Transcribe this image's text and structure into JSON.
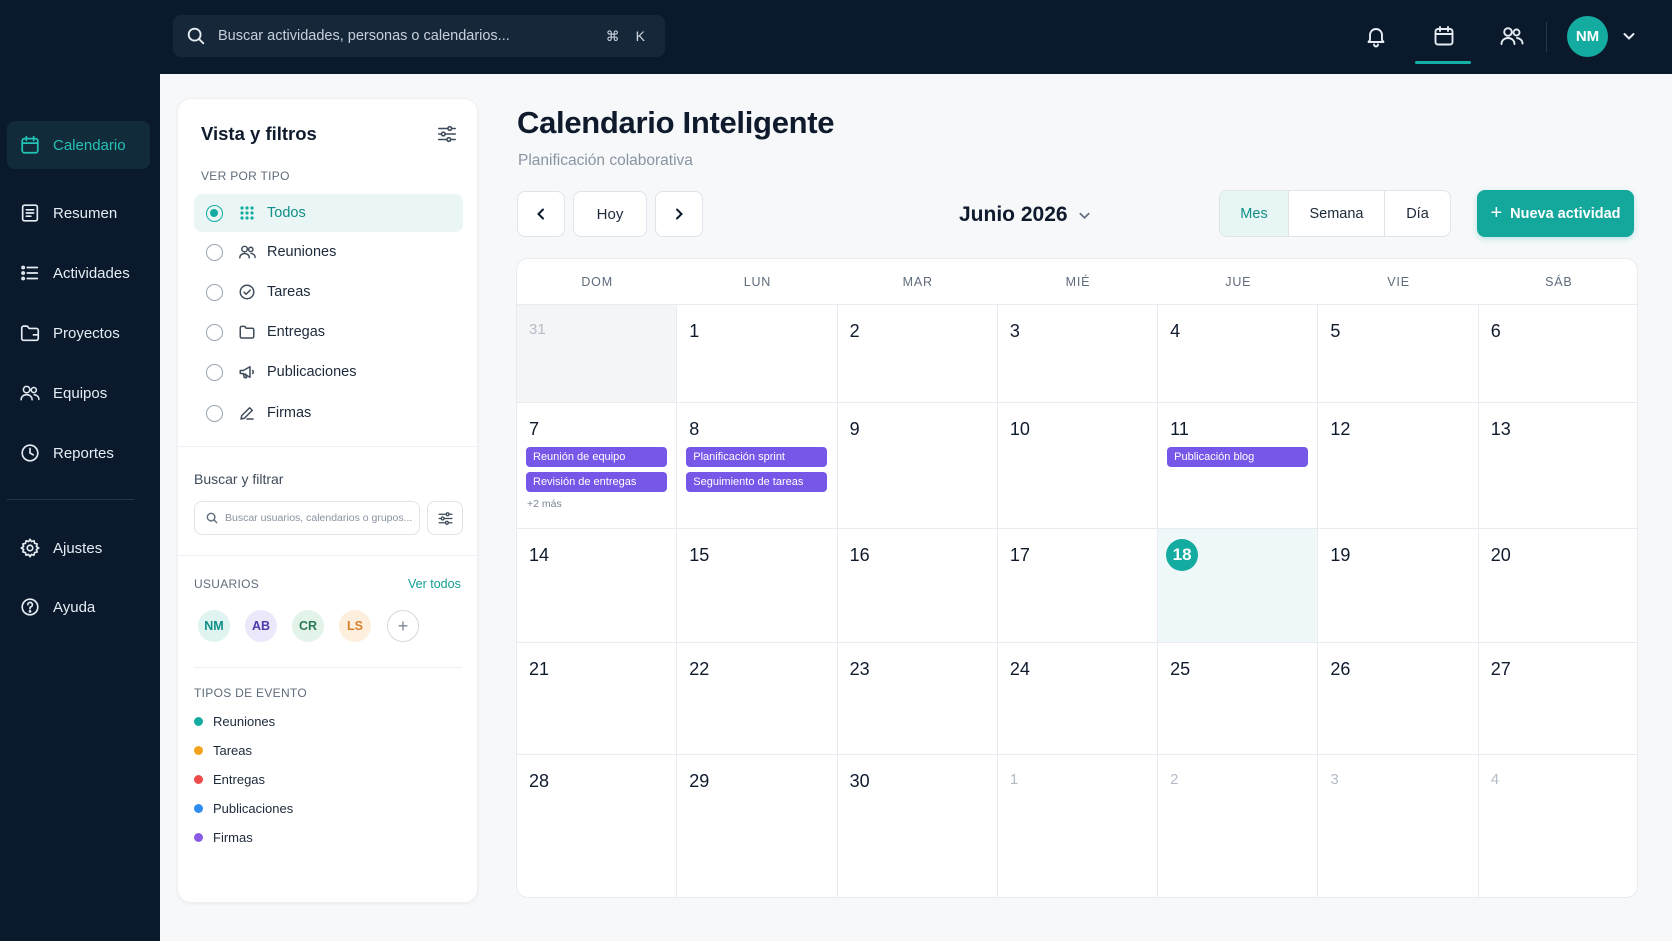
{
  "topbar": {
    "search_placeholder": "Buscar actividades, personas o calendarios...",
    "shortcut": "⌘ K",
    "avatar_initials": "NM",
    "icons": [
      "bell-icon",
      "calendar-icon",
      "users-icon",
      "chevron-down-icon"
    ]
  },
  "nav": {
    "items": [
      {
        "label": "Calendario",
        "icon": "calendar-icon",
        "active": true
      },
      {
        "label": "Resumen",
        "icon": "summary-icon"
      },
      {
        "label": "Actividades",
        "icon": "list-icon"
      },
      {
        "label": "Proyectos",
        "icon": "folder-icon"
      },
      {
        "label": "Equipos",
        "icon": "users-icon"
      },
      {
        "label": "Reportes",
        "icon": "clock-icon"
      },
      {
        "label": "Ajustes",
        "icon": "gear-icon"
      },
      {
        "label": "Ayuda",
        "icon": "help-icon"
      }
    ]
  },
  "filters": {
    "title": "Vista y filtros",
    "by_type_label": "VER POR TIPO",
    "types": [
      {
        "label": "Todos",
        "icon": "grid-icon",
        "selected": true
      },
      {
        "label": "Reuniones",
        "icon": "users-icon"
      },
      {
        "label": "Tareas",
        "icon": "check-circle-icon"
      },
      {
        "label": "Entregas",
        "icon": "folder-icon"
      },
      {
        "label": "Publicaciones",
        "icon": "megaphone-icon"
      },
      {
        "label": "Firmas",
        "icon": "pen-icon"
      }
    ],
    "search_heading": "Buscar y filtrar",
    "search_placeholder": "Buscar usuarios, calendarios o grupos...",
    "users_label": "USUARIOS",
    "see_all": "Ver todos",
    "users": [
      {
        "initials": "NM",
        "bg": "#dff3f1",
        "fg": "#0f8f87"
      },
      {
        "initials": "AB",
        "bg": "#ece8fb",
        "fg": "#4a3aa8"
      },
      {
        "initials": "CR",
        "bg": "#e3f3ea",
        "fg": "#2c7a55"
      },
      {
        "initials": "LS",
        "bg": "#fdeedd",
        "fg": "#d6812a"
      }
    ],
    "event_types_label": "TIPOS DE EVENTO",
    "event_types": [
      {
        "label": "Reuniones",
        "color": "#14aba0"
      },
      {
        "label": "Tareas",
        "color": "#f4a21d"
      },
      {
        "label": "Entregas",
        "color": "#ef4b4b"
      },
      {
        "label": "Publicaciones",
        "color": "#2f8cf0"
      },
      {
        "label": "Firmas",
        "color": "#8a5ce6"
      }
    ]
  },
  "main": {
    "title": "Calendario Inteligente",
    "subtitle": "Planificación colaborativa",
    "today_label": "Hoy",
    "month_label": "Junio 2026",
    "views": [
      {
        "label": "Mes",
        "active": true
      },
      {
        "label": "Semana"
      },
      {
        "label": "Día"
      }
    ],
    "new_activity_label": "Nueva actividad"
  },
  "calendar": {
    "weekdays": [
      "DOM",
      "LUN",
      "MAR",
      "MIÉ",
      "JUE",
      "VIE",
      "SÁB"
    ],
    "weeks": [
      [
        {
          "day": "31",
          "state": "prev"
        },
        {
          "day": "1"
        },
        {
          "day": "2"
        },
        {
          "day": "3"
        },
        {
          "day": "4"
        },
        {
          "day": "5"
        },
        {
          "day": "6"
        }
      ],
      [
        {
          "day": "7",
          "events": [
            "Reunión de equipo",
            "Revisión de entregas"
          ],
          "more": "+2 más"
        },
        {
          "day": "8",
          "events": [
            "Planificación sprint",
            "Seguimiento de tareas"
          ]
        },
        {
          "day": "9"
        },
        {
          "day": "10"
        },
        {
          "day": "11",
          "events": [
            "Publicación blog"
          ]
        },
        {
          "day": "12"
        },
        {
          "day": "13"
        }
      ],
      [
        {
          "day": "14"
        },
        {
          "day": "15"
        },
        {
          "day": "16"
        },
        {
          "day": "17"
        },
        {
          "day": "18",
          "state": "today"
        },
        {
          "day": "19"
        },
        {
          "day": "20"
        }
      ],
      [
        {
          "day": "21"
        },
        {
          "day": "22"
        },
        {
          "day": "23"
        },
        {
          "day": "24"
        },
        {
          "day": "25"
        },
        {
          "day": "26"
        },
        {
          "day": "27"
        }
      ],
      [
        {
          "day": "28"
        },
        {
          "day": "29"
        },
        {
          "day": "30"
        },
        {
          "day": "1",
          "state": "next"
        },
        {
          "day": "2",
          "state": "next"
        },
        {
          "day": "3",
          "state": "next"
        },
        {
          "day": "4",
          "state": "next"
        }
      ]
    ]
  }
}
